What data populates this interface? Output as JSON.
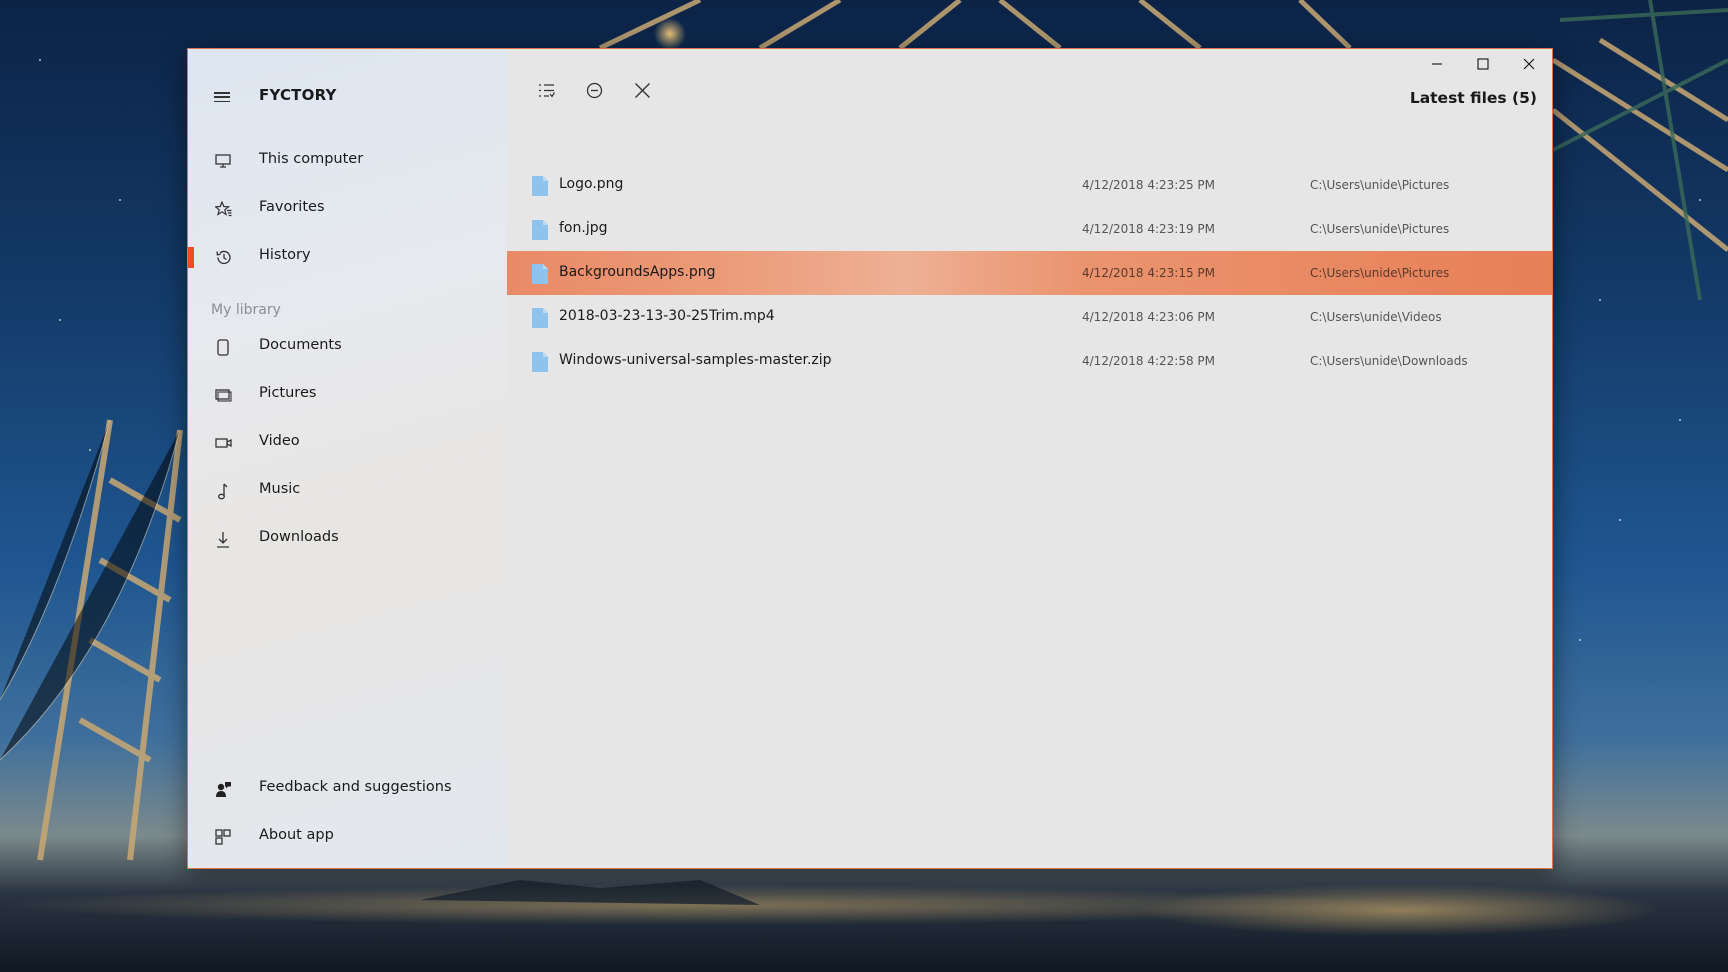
{
  "window": {
    "app_title": "FYCTORY",
    "accent_color": "#e8501e",
    "controls": {
      "minimize_icon": "minimize-icon",
      "maximize_icon": "maximize-icon",
      "close_icon": "close-icon"
    }
  },
  "sidebar": {
    "nav": [
      {
        "label": "This computer",
        "icon": "computer-icon",
        "active": false
      },
      {
        "label": "Favorites",
        "icon": "favorites-icon",
        "active": false
      },
      {
        "label": "History",
        "icon": "history-icon",
        "active": true
      }
    ],
    "library_label": "My library",
    "library": [
      {
        "label": "Documents",
        "icon": "document-icon"
      },
      {
        "label": "Pictures",
        "icon": "pictures-icon"
      },
      {
        "label": "Video",
        "icon": "video-icon"
      },
      {
        "label": "Music",
        "icon": "music-icon"
      },
      {
        "label": "Downloads",
        "icon": "download-icon"
      }
    ],
    "footer": [
      {
        "label": "Feedback and suggestions",
        "icon": "feedback-icon"
      },
      {
        "label": "About app",
        "icon": "about-icon"
      }
    ]
  },
  "main": {
    "title": "Latest files (5)",
    "toolbar": [
      "list-view-icon",
      "remove-icon",
      "close-icon"
    ],
    "files": [
      {
        "name": "Logo.png",
        "date": "4/12/2018 4:23:25 PM",
        "path": "C:\\Users\\unide\\Pictures",
        "selected": false
      },
      {
        "name": "fon.jpg",
        "date": "4/12/2018 4:23:19 PM",
        "path": "C:\\Users\\unide\\Pictures",
        "selected": false
      },
      {
        "name": "BackgroundsApps.png",
        "date": "4/12/2018 4:23:15 PM",
        "path": "C:\\Users\\unide\\Pictures",
        "selected": true
      },
      {
        "name": "2018-03-23-13-30-25Trim.mp4",
        "date": "4/12/2018 4:23:06 PM",
        "path": "C:\\Users\\unide\\Videos",
        "selected": false
      },
      {
        "name": "Windows-universal-samples-master.zip",
        "date": "4/12/2018 4:22:58 PM",
        "path": "C:\\Users\\unide\\Downloads",
        "selected": false
      }
    ],
    "file_icon_color": "#8ec3ee"
  }
}
